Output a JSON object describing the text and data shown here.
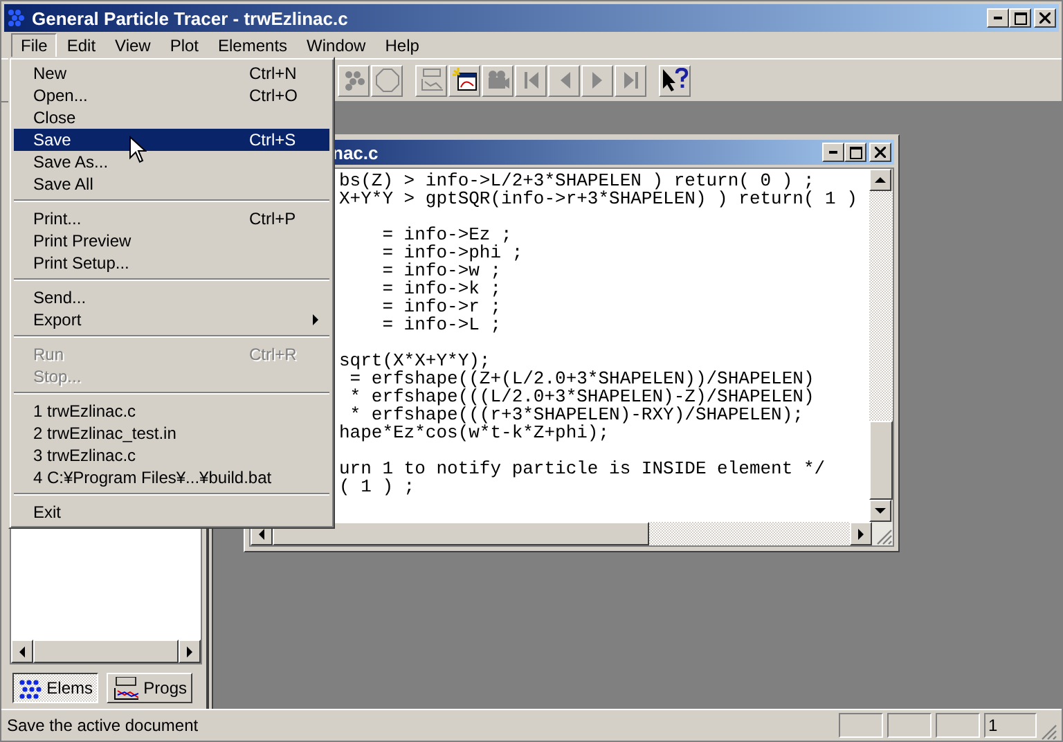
{
  "window": {
    "title": "General Particle Tracer - trwEzlinac.c"
  },
  "menu_bar": [
    {
      "label": "File",
      "selected": true
    },
    {
      "label": "Edit",
      "selected": false
    },
    {
      "label": "View",
      "selected": false
    },
    {
      "label": "Plot",
      "selected": false
    },
    {
      "label": "Elements",
      "selected": false
    },
    {
      "label": "Window",
      "selected": false
    },
    {
      "label": "Help",
      "selected": false
    }
  ],
  "file_menu": [
    {
      "kind": "item",
      "label": "New",
      "shortcut": "Ctrl+N",
      "disabled": false,
      "selected": false
    },
    {
      "kind": "item",
      "label": "Open...",
      "shortcut": "Ctrl+O",
      "disabled": false,
      "selected": false
    },
    {
      "kind": "item",
      "label": "Close",
      "disabled": false,
      "selected": false
    },
    {
      "kind": "item",
      "label": "Save",
      "shortcut": "Ctrl+S",
      "disabled": false,
      "selected": true
    },
    {
      "kind": "item",
      "label": "Save As...",
      "disabled": false,
      "selected": false
    },
    {
      "kind": "item",
      "label": "Save All",
      "disabled": false,
      "selected": false
    },
    {
      "kind": "separator"
    },
    {
      "kind": "item",
      "label": "Print...",
      "shortcut": "Ctrl+P",
      "disabled": false,
      "selected": false
    },
    {
      "kind": "item",
      "label": "Print Preview",
      "disabled": false,
      "selected": false
    },
    {
      "kind": "item",
      "label": "Print Setup...",
      "disabled": false,
      "selected": false
    },
    {
      "kind": "separator"
    },
    {
      "kind": "item",
      "label": "Send...",
      "disabled": false,
      "selected": false
    },
    {
      "kind": "submenu",
      "label": "Export",
      "disabled": false,
      "selected": false
    },
    {
      "kind": "separator"
    },
    {
      "kind": "item",
      "label": "Run",
      "shortcut": "Ctrl+R",
      "disabled": true,
      "selected": false
    },
    {
      "kind": "item",
      "label": "Stop...",
      "disabled": true,
      "selected": false
    },
    {
      "kind": "separator"
    },
    {
      "kind": "item",
      "label": "1 trwEzlinac.c",
      "disabled": false,
      "selected": false
    },
    {
      "kind": "item",
      "label": "2 trwEzlinac_test.in",
      "disabled": false,
      "selected": false
    },
    {
      "kind": "item",
      "label": "3 trwEzlinac.c",
      "disabled": false,
      "selected": false
    },
    {
      "kind": "item",
      "label": "4 C:¥Program Files¥...¥build.bat",
      "disabled": false,
      "selected": false
    },
    {
      "kind": "separator"
    },
    {
      "kind": "item",
      "label": "Exit",
      "disabled": false,
      "selected": false
    }
  ],
  "editor": {
    "title": "nac.c",
    "lines": [
      {
        "kind": "code",
        "text": "bs(Z) > info->L/2+3*SHAPELEN ) return( 0 ) ;"
      },
      {
        "kind": "code",
        "text": "X+Y*Y > gptSQR(info->r+3*SHAPELEN) ) return( 1 )"
      },
      {
        "kind": "blank"
      },
      {
        "kind": "code",
        "text": "    = info->Ez ;"
      },
      {
        "kind": "code",
        "text": "    = info->phi ;"
      },
      {
        "kind": "code",
        "text": "    = info->w ;"
      },
      {
        "kind": "code",
        "text": "    = info->k ;"
      },
      {
        "kind": "code",
        "text": "    = info->r ;"
      },
      {
        "kind": "code",
        "text": "    = info->L ;"
      },
      {
        "kind": "blank"
      },
      {
        "kind": "code",
        "text": "sqrt(X*X+Y*Y);"
      },
      {
        "kind": "code",
        "text": " = erfshape((Z+(L/2.0+3*SHAPELEN))/SHAPELEN)"
      },
      {
        "kind": "code",
        "text": " * erfshape(((L/2.0+3*SHAPELEN)-Z)/SHAPELEN)"
      },
      {
        "kind": "code",
        "text": " * erfshape(((r+3*SHAPELEN)-RXY)/SHAPELEN);"
      },
      {
        "kind": "code",
        "text": "hape*Ez*cos(w*t-k*Z+phi);"
      },
      {
        "kind": "blank"
      },
      {
        "kind": "code",
        "text": "urn 1 to notify particle is INSIDE element */"
      },
      {
        "kind": "code",
        "text": "( 1 ) ;"
      }
    ]
  },
  "sidebar_tabs": [
    {
      "label": "Elems",
      "selected": true
    },
    {
      "label": "Progs",
      "selected": false
    }
  ],
  "status_bar": {
    "message": "Save the active document",
    "panes": [
      "1"
    ]
  }
}
